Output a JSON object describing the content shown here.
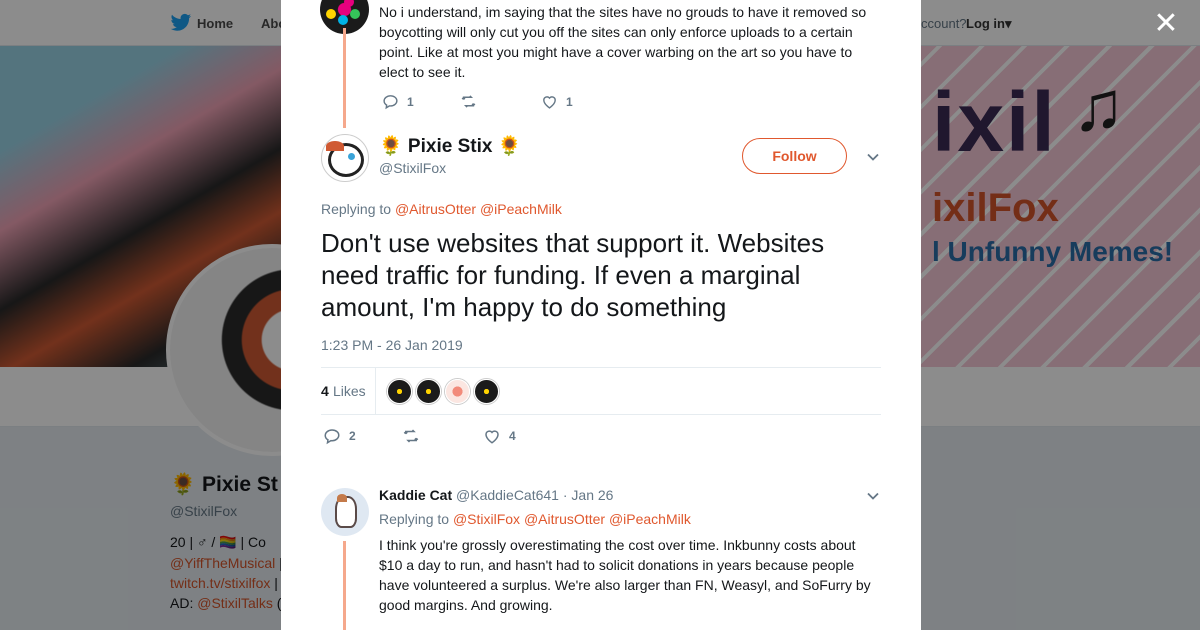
{
  "topnav": {
    "home": "Home",
    "about": "Abo",
    "account_prompt": "ccount?",
    "login": "Log in"
  },
  "banner": {
    "title": "ixil",
    "subtitle1": "ixilFox",
    "subtitle2": "l Unfunny Memes!"
  },
  "profile": {
    "name": "🌻 Pixie St",
    "handle": "@StixilFox",
    "bio_line1": "20 | ♂ / 🏳️‍🌈 | Co",
    "bio_line2_link": "@YiffTheMusical",
    "bio_line2_rest": " |",
    "bio_line3_link": "twitch.tv/stixilfox",
    "bio_line3_rest": " |",
    "bio_line4_prefix": "AD: ",
    "bio_line4_link": "@StixilTalks",
    "bio_line4_rest": " ("
  },
  "previous_tweet": {
    "text": "No i understand, im saying that the sites have no grouds to have it removed so boycotting will only cut you off the sites can only enforce uploads to a certain point. Like at most you might have a cover warbing on the art so you have to elect to see it.",
    "replies": "1",
    "retweets": "",
    "likes": "1"
  },
  "main_tweet": {
    "name": "🌻 Pixie Stix 🌻",
    "handle": "@StixilFox",
    "follow_label": "Follow",
    "replying_prefix": "Replying to ",
    "replying_to_1": "@AitrusOtter",
    "replying_to_2": "@iPeachMilk",
    "text": "Don't use websites that support it. Websites need traffic for funding. If even a marginal amount, I'm happy to do something",
    "timestamp": "1:23 PM - 26 Jan 2019",
    "likes_count": "4",
    "likes_label": "Likes",
    "replies": "2",
    "retweets": "",
    "likes": "4"
  },
  "reply_tweet": {
    "name": "Kaddie Cat",
    "handle": "@KaddieCat641",
    "date": "· Jan 26",
    "replying_prefix": "Replying to ",
    "replying_to_1": "@StixilFox",
    "replying_to_2": "@AitrusOtter",
    "replying_to_3": "@iPeachMilk",
    "text": "I think you're grossly overestimating the cost over time. Inkbunny costs about $10 a day to run, and hasn't had to solicit donations in years because people have volunteered a surplus. We're also larger than FN, Weasyl, and SoFurry by good margins. And growing."
  },
  "colors": {
    "accent": "#e0582e",
    "thread_line": "#f5a88c",
    "muted": "#657786"
  },
  "icons": [
    "twitter-bird-icon",
    "close-icon",
    "reply-icon",
    "retweet-icon",
    "heart-icon",
    "chevron-down-icon"
  ]
}
